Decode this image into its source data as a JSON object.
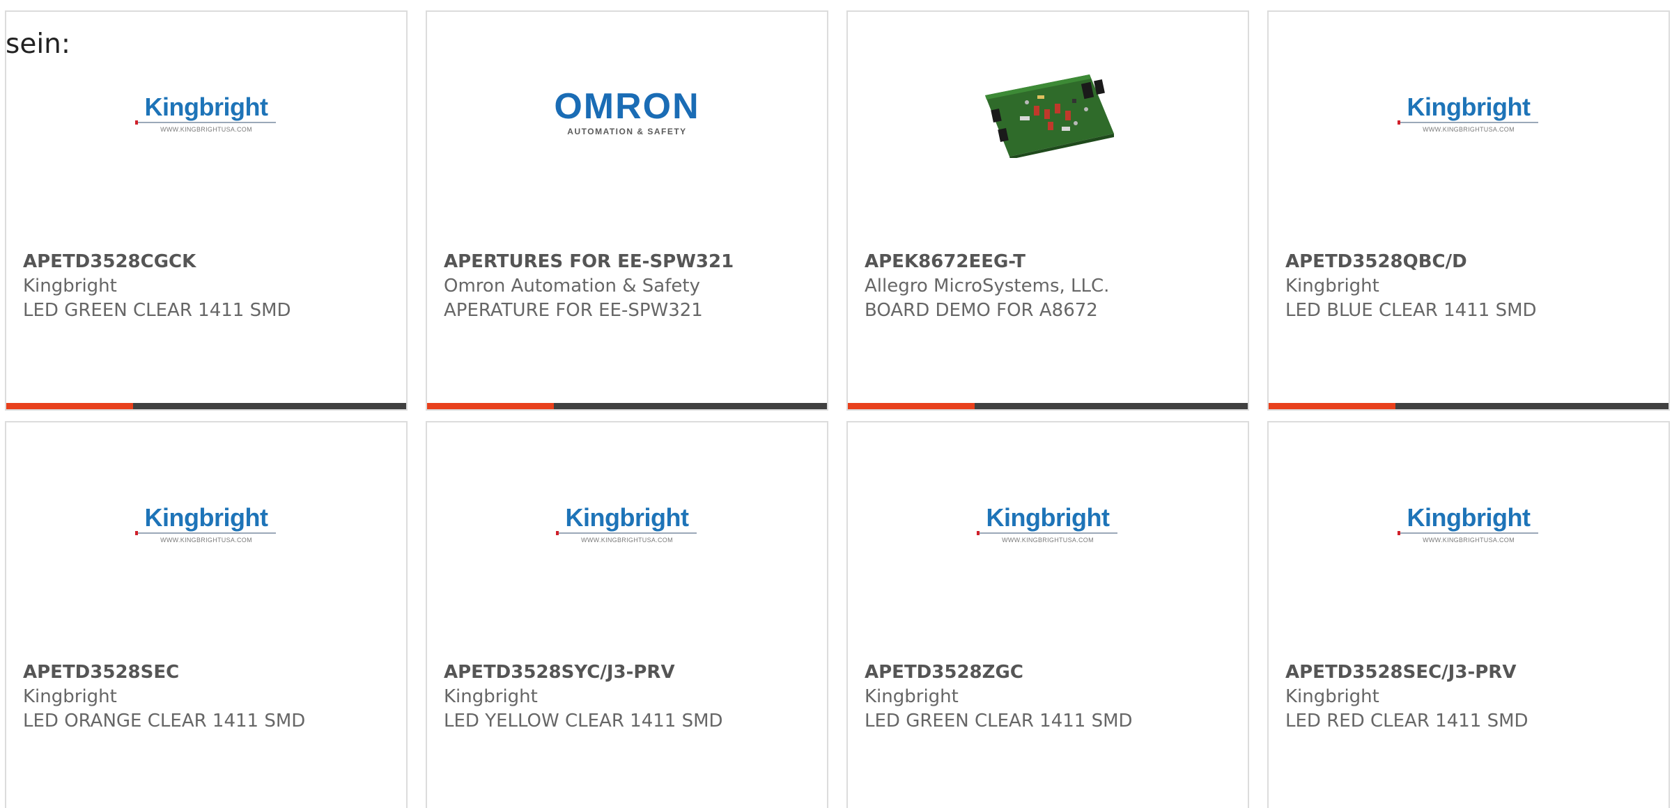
{
  "intro_text": "sein:",
  "colors": {
    "accent": "#e8401c",
    "bar_dark": "#404040",
    "card_border": "#dcdcdc",
    "kingbright_blue": "#1e74b8",
    "omron_blue": "#1a6cb5"
  },
  "products": [
    {
      "part_number": "APETD3528CGCK",
      "manufacturer": "Kingbright",
      "description": "LED GREEN CLEAR 1411 SMD",
      "logo": {
        "type": "kingbright",
        "word": "Kingbright",
        "url": "WWW.KINGBRIGHTUSA.COM"
      }
    },
    {
      "part_number": "APERTURES FOR EE-SPW321",
      "manufacturer": "Omron Automation & Safety",
      "description": "APERATURE FOR EE-SPW321",
      "logo": {
        "type": "omron",
        "word": "OMRON",
        "sub": "AUTOMATION & SAFETY"
      }
    },
    {
      "part_number": "APEK8672EEG-T",
      "manufacturer": "Allegro MicroSystems, LLC.",
      "description": "BOARD DEMO FOR A8672",
      "logo": {
        "type": "pcb-photo"
      }
    },
    {
      "part_number": "APETD3528QBC/D",
      "manufacturer": "Kingbright",
      "description": "LED BLUE CLEAR 1411 SMD",
      "logo": {
        "type": "kingbright",
        "word": "Kingbright",
        "url": "WWW.KINGBRIGHTUSA.COM"
      }
    },
    {
      "part_number": "APETD3528SEC",
      "manufacturer": "Kingbright",
      "description": "LED ORANGE CLEAR 1411 SMD",
      "logo": {
        "type": "kingbright",
        "word": "Kingbright",
        "url": "WWW.KINGBRIGHTUSA.COM"
      }
    },
    {
      "part_number": "APETD3528SYC/J3-PRV",
      "manufacturer": "Kingbright",
      "description": "LED YELLOW CLEAR 1411 SMD",
      "logo": {
        "type": "kingbright",
        "word": "Kingbright",
        "url": "WWW.KINGBRIGHTUSA.COM"
      }
    },
    {
      "part_number": "APETD3528ZGC",
      "manufacturer": "Kingbright",
      "description": "LED GREEN CLEAR 1411 SMD",
      "logo": {
        "type": "kingbright",
        "word": "Kingbright",
        "url": "WWW.KINGBRIGHTUSA.COM"
      }
    },
    {
      "part_number": "APETD3528SEC/J3-PRV",
      "manufacturer": "Kingbright",
      "description": "LED RED CLEAR 1411 SMD",
      "logo": {
        "type": "kingbright",
        "word": "Kingbright",
        "url": "WWW.KINGBRIGHTUSA.COM"
      }
    }
  ]
}
